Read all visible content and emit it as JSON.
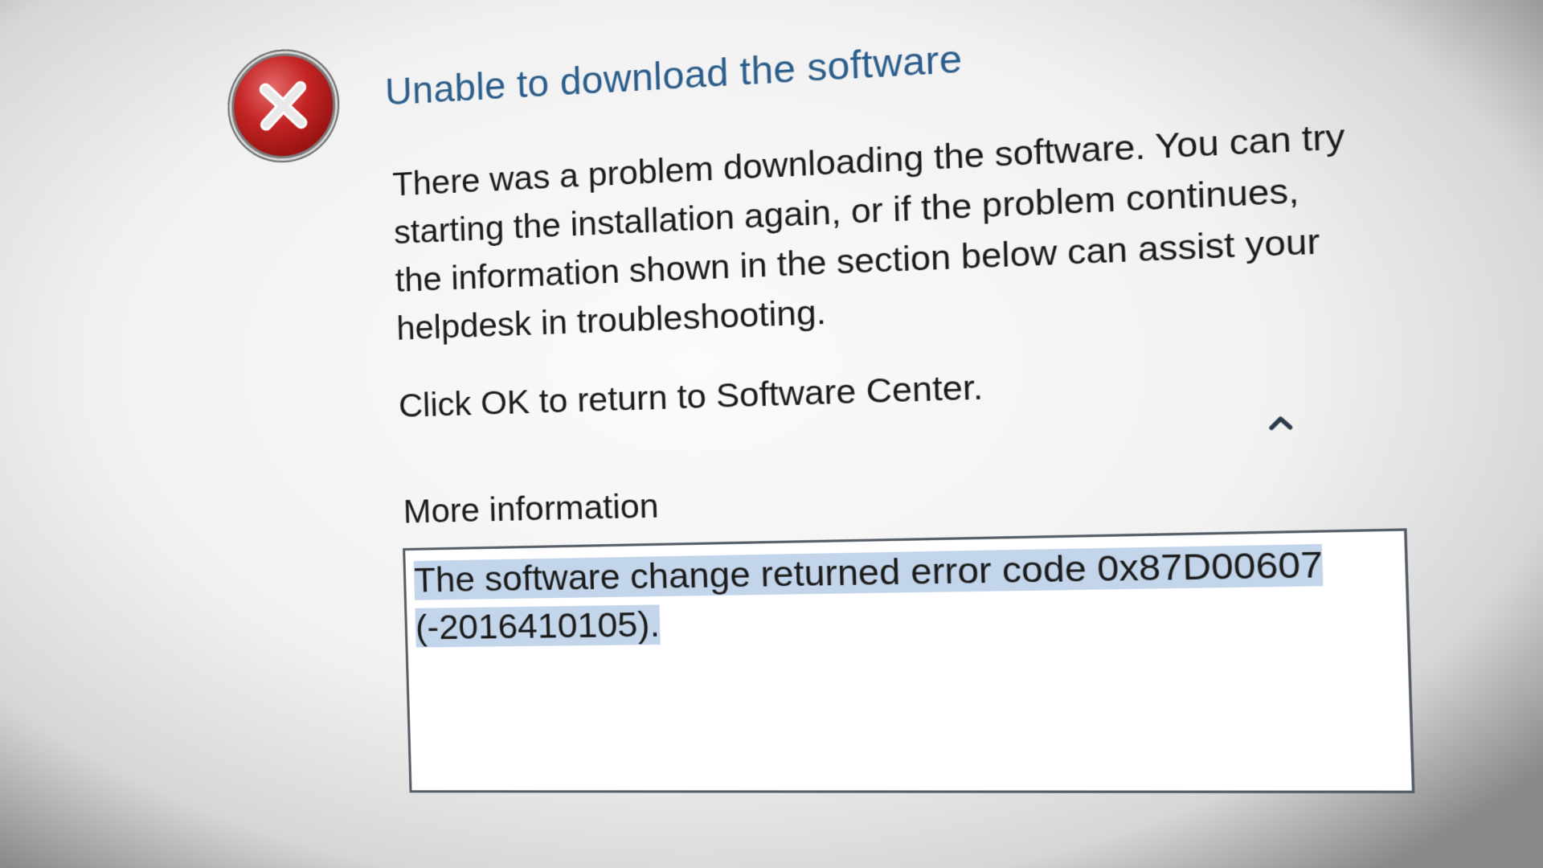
{
  "dialog": {
    "title": "Unable to download the software",
    "icon": "error-icon",
    "message_lines": [
      "There was a problem downloading the software.  You can try",
      "starting the installation again, or if the problem continues,",
      "the information shown in the section below can assist your",
      "helpdesk in troubleshooting."
    ],
    "click_ok_text": "Click OK to return to Software Center.",
    "collapse_icon": "chevron-up-icon",
    "more_information_label": "More information",
    "error_details": {
      "line1": "The software change returned error code 0x87D00607",
      "line2": "(-2016410105)."
    }
  },
  "colors": {
    "title": "#2b5d8a",
    "text": "#1a1a1a",
    "selection": "#c3d5ea",
    "error_red": "#c42424"
  }
}
